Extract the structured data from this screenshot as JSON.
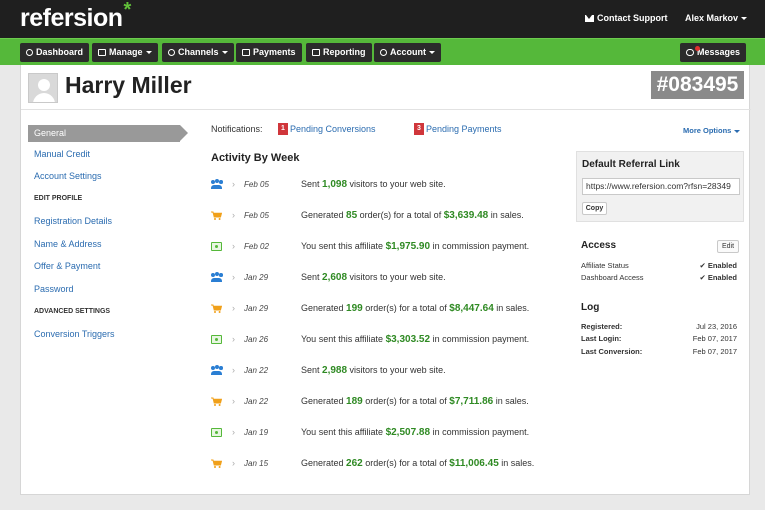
{
  "brand": {
    "logo": "refersion",
    "logo_mark": "*"
  },
  "topbar": {
    "contact_label": "Contact Support",
    "user_name": "Alex Markov"
  },
  "nav": {
    "items": [
      {
        "label": "Dashboard",
        "icon": "dashboard-icon",
        "caret": false
      },
      {
        "label": "Manage",
        "icon": "edit-icon",
        "caret": true
      },
      {
        "label": "Channels",
        "icon": "rss-icon",
        "caret": true
      },
      {
        "label": "Payments",
        "icon": "money-icon",
        "caret": false
      },
      {
        "label": "Reporting",
        "icon": "chart-icon",
        "caret": false
      },
      {
        "label": "Account",
        "icon": "user-icon",
        "caret": true
      }
    ],
    "messages_label": "Messages"
  },
  "profile": {
    "name": "Harry Miller",
    "affiliate_id": "#083495"
  },
  "sidebar": {
    "active": "General",
    "links_top": [
      "Manual Credit",
      "Account Settings"
    ],
    "heading_edit": "EDIT PROFILE",
    "links_edit": [
      "Registration Details",
      "Name & Address",
      "Offer & Payment",
      "Password"
    ],
    "heading_advanced": "ADVANCED SETTINGS",
    "links_advanced": [
      "Conversion Triggers"
    ]
  },
  "notifications": {
    "label": "Notifications:",
    "items": [
      {
        "count": "1",
        "label": "Pending Conversions"
      },
      {
        "count": "3",
        "label": "Pending Payments"
      }
    ],
    "more_options": "More Options"
  },
  "activity": {
    "title": "Activity By Week",
    "rows": [
      {
        "type": "visitors",
        "icon": "users-icon",
        "date": "Feb 05",
        "pre": "Sent ",
        "value": "1,098",
        "post": " visitors to your web site."
      },
      {
        "type": "orders",
        "icon": "cart-icon",
        "date": "Feb 05",
        "pre": "Generated ",
        "value": "85",
        "mid": " order(s) for a total of ",
        "amount": "$3,639.48",
        "post": " in sales."
      },
      {
        "type": "payment",
        "icon": "money-icon",
        "date": "Feb 02",
        "pre": "You sent this affiliate ",
        "value": "$1,975.90",
        "post": " in commission payment."
      },
      {
        "type": "visitors",
        "icon": "users-icon",
        "date": "Jan 29",
        "pre": "Sent ",
        "value": "2,608",
        "post": " visitors to your web site."
      },
      {
        "type": "orders",
        "icon": "cart-icon",
        "date": "Jan 29",
        "pre": "Generated ",
        "value": "199",
        "mid": " order(s) for a total of ",
        "amount": "$8,447.64",
        "post": " in sales."
      },
      {
        "type": "payment",
        "icon": "money-icon",
        "date": "Jan 26",
        "pre": "You sent this affiliate ",
        "value": "$3,303.52",
        "post": " in commission payment."
      },
      {
        "type": "visitors",
        "icon": "users-icon",
        "date": "Jan 22",
        "pre": "Sent ",
        "value": "2,988",
        "post": " visitors to your web site."
      },
      {
        "type": "orders",
        "icon": "cart-icon",
        "date": "Jan 22",
        "pre": "Generated ",
        "value": "189",
        "mid": " order(s) for a total of ",
        "amount": "$7,711.86",
        "post": " in sales."
      },
      {
        "type": "payment",
        "icon": "money-icon",
        "date": "Jan 19",
        "pre": "You sent this affiliate ",
        "value": "$2,507.88",
        "post": " in commission payment."
      },
      {
        "type": "orders",
        "icon": "cart-icon",
        "date": "Jan 15",
        "pre": "Generated ",
        "value": "262",
        "mid": " order(s) for a total of ",
        "amount": "$11,006.45",
        "post": " in sales."
      }
    ]
  },
  "referral": {
    "title": "Default Referral Link",
    "url": "https://www.refersion.com?rfsn=28349",
    "copy_label": "Copy"
  },
  "access": {
    "title": "Access",
    "edit_label": "Edit",
    "items": [
      {
        "label": "Affiliate Status",
        "value": "Enabled"
      },
      {
        "label": "Dashboard Access",
        "value": "Enabled"
      }
    ]
  },
  "log": {
    "title": "Log",
    "items": [
      {
        "label": "Registered:",
        "value": "Jul 23, 2016"
      },
      {
        "label": "Last Login:",
        "value": "Feb 07, 2017"
      },
      {
        "label": "Last Conversion:",
        "value": "Feb 07, 2017"
      }
    ]
  },
  "colors": {
    "brand_green": "#55b83a",
    "value_green": "#2f8a23",
    "link_blue": "#2b6cb0",
    "badge_red": "#d0363b"
  }
}
